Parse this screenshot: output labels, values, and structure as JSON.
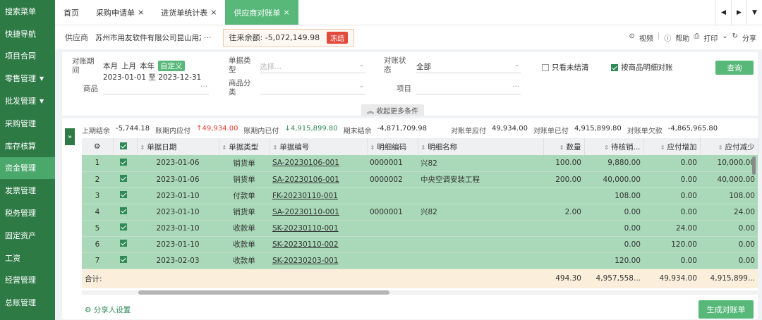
{
  "sidebar": {
    "items": [
      {
        "label": "搜索菜单",
        "caret": false
      },
      {
        "label": "快捷导航",
        "caret": false
      },
      {
        "label": "项目合同",
        "caret": false
      },
      {
        "label": "零售管理",
        "caret": true
      },
      {
        "label": "批发管理",
        "caret": true
      },
      {
        "label": "采购管理",
        "caret": false
      },
      {
        "label": "库存核算",
        "caret": false
      },
      {
        "label": "资金管理",
        "caret": false,
        "active": true
      },
      {
        "label": "发票管理",
        "caret": false
      },
      {
        "label": "税务管理",
        "caret": false
      },
      {
        "label": "固定资产",
        "caret": false
      },
      {
        "label": "工资",
        "caret": false
      },
      {
        "label": "经营管理",
        "caret": false
      },
      {
        "label": "总账管理",
        "caret": false
      }
    ]
  },
  "tabs": [
    {
      "label": "首页",
      "closable": false
    },
    {
      "label": "采购申请单",
      "closable": true
    },
    {
      "label": "进货单统计表",
      "closable": true
    },
    {
      "label": "供应商对账单",
      "closable": true,
      "active": true
    }
  ],
  "infobar": {
    "supplier_label": "供应商",
    "supplier_value": "苏州市用友软件有限公司昆山用友软...",
    "balance_text": "往来余额: -5,072,149.98",
    "freeze_badge": "冻结",
    "video": "视频",
    "help": "帮助",
    "print": "打印",
    "share": "分享"
  },
  "filters": {
    "period_label": "对账期间",
    "period_options": [
      "本月",
      "上月",
      "本年"
    ],
    "period_selected": "自定义",
    "date_range": "2023-01-01 至 2023-12-31",
    "doc_type_label": "单据类型",
    "doc_type_placeholder": "选择...",
    "status_label": "对账状态",
    "status_value": "全部",
    "only_unsettled": "只看未结清",
    "by_goods_detail": "按商品明细对账",
    "query_button": "查询",
    "goods_label": "商品",
    "goods_category_label": "商品分类",
    "project_label": "项目",
    "collapse_text": "收起更多条件"
  },
  "summary": {
    "prev_balance_label": "上期结余",
    "prev_balance": "-5,744.18",
    "payable_in_period_label": "账期内应付",
    "payable_in_period": "49,934.00",
    "paid_in_period_label": "账期内已付",
    "paid_in_period": "4,915,899.80",
    "end_balance_label": "期末结余",
    "end_balance": "-4,871,709.98",
    "stmt_payable_label": "对账单应付",
    "stmt_payable": "49,934.00",
    "stmt_paid_label": "对账单已付",
    "stmt_paid": "4,915,899.80",
    "stmt_owed_label": "对账单欠款",
    "stmt_owed": "-4,865,965.80"
  },
  "table": {
    "headers": [
      "单据日期",
      "单据类型",
      "单据编号",
      "明细编码",
      "明细名称",
      "数量",
      "待核销...",
      "应付增加",
      "应付减少"
    ],
    "rows": [
      {
        "no": "1",
        "date": "2023-01-06",
        "type": "销货单",
        "code": "SA-20230106-001",
        "item_code": "0000001",
        "item_name": "兴82",
        "qty": "100.00",
        "pending": "9,880.00",
        "inc": "0.00",
        "dec": "10,000.00"
      },
      {
        "no": "2",
        "date": "2023-01-06",
        "type": "销货单",
        "code": "SA-20230106-001",
        "item_code": "0000002",
        "item_name": "中央空调安装工程",
        "qty": "200.00",
        "pending": "40,000.00",
        "inc": "0.00",
        "dec": "40,000.00"
      },
      {
        "no": "3",
        "date": "2023-01-10",
        "type": "付款单",
        "code": "FK-20230110-001",
        "item_code": "",
        "item_name": "",
        "qty": "",
        "pending": "108.00",
        "inc": "0.00",
        "dec": "108.00"
      },
      {
        "no": "4",
        "date": "2023-01-10",
        "type": "销货单",
        "code": "SA-20230110-001",
        "item_code": "0000001",
        "item_name": "兴82",
        "qty": "2.00",
        "pending": "0.00",
        "inc": "0.00",
        "dec": "24.00"
      },
      {
        "no": "5",
        "date": "2023-01-10",
        "type": "收款单",
        "code": "SK-20230110-001",
        "item_code": "",
        "item_name": "",
        "qty": "",
        "pending": "0.00",
        "inc": "24.00",
        "dec": "0.00"
      },
      {
        "no": "6",
        "date": "2023-01-10",
        "type": "收款单",
        "code": "SK-20230110-002",
        "item_code": "",
        "item_name": "",
        "qty": "",
        "pending": "0.00",
        "inc": "120.00",
        "dec": "0.00"
      },
      {
        "no": "7",
        "date": "2023-02-03",
        "type": "收款单",
        "code": "SK-20230203-001",
        "item_code": "",
        "item_name": "",
        "qty": "",
        "pending": "120.00",
        "inc": "0.00",
        "dec": "0.00"
      }
    ],
    "total": {
      "label": "合计:",
      "qty": "494.30",
      "pending": "4,957,558...",
      "inc": "49,934.00",
      "dec": "4,915,899..."
    }
  },
  "footer": {
    "share_settings": "分享人设置",
    "generate_button": "生成对账单"
  }
}
